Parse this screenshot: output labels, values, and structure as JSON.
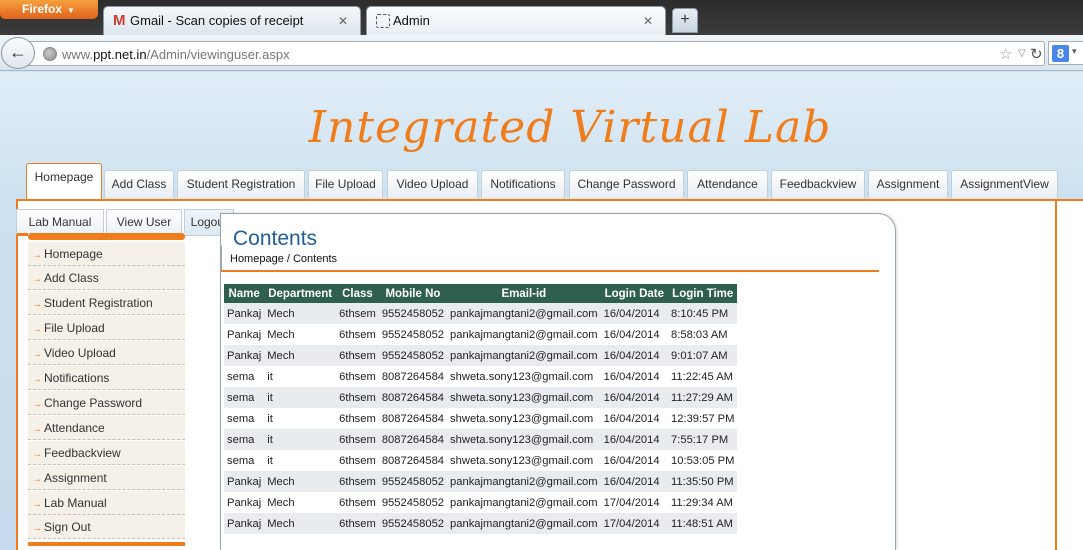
{
  "browser": {
    "menu_label": "Firefox",
    "tabs": [
      {
        "title": "Gmail - Scan copies of receipt",
        "icon": "gmail-icon"
      },
      {
        "title": "Admin",
        "icon": "page-icon"
      }
    ],
    "url_prefix": "www.",
    "url_domain": "ppt.net.in",
    "url_path": "/Admin/viewinguser.aspx"
  },
  "site": {
    "title": "Integrated Virtual Lab"
  },
  "menu": {
    "items": [
      "Homepage",
      "Add Class",
      "Student Registration",
      "File Upload",
      "Video Upload",
      "Notifications",
      "Change Password",
      "Attendance",
      "Feedbackview",
      "Assignment",
      "AssignmentView"
    ],
    "active": "Homepage"
  },
  "submenu": {
    "items": [
      "Lab Manual",
      "View User",
      "Logout"
    ]
  },
  "sidebar": {
    "items": [
      "Homepage",
      "Add Class",
      "Student Registration",
      "File Upload",
      "Video Upload",
      "Notifications",
      "Change Password",
      "Attendance",
      "Feedbackview",
      "Assignment",
      "Lab Manual",
      "Sign Out"
    ]
  },
  "content": {
    "title": "Contents",
    "breadcrumb": "Homepage / Contents"
  },
  "table": {
    "headers": [
      "Name",
      "Department",
      "Class",
      "Mobile No",
      "Email-id",
      "Login Date",
      "Login Time"
    ],
    "rows": [
      [
        "Pankaj",
        "Mech",
        "6thsem",
        "9552458052",
        "pankajmangtani2@gmail.com",
        "16/04/2014",
        "8:10:45 PM"
      ],
      [
        "Pankaj",
        "Mech",
        "6thsem",
        "9552458052",
        "pankajmangtani2@gmail.com",
        "16/04/2014",
        "8:58:03 AM"
      ],
      [
        "Pankaj",
        "Mech",
        "6thsem",
        "9552458052",
        "pankajmangtani2@gmail.com",
        "16/04/2014",
        "9:01:07 AM"
      ],
      [
        "sema",
        "it",
        "6thsem",
        "8087264584",
        "shweta.sony123@gmail.com",
        "16/04/2014",
        "11:22:45 AM"
      ],
      [
        "sema",
        "it",
        "6thsem",
        "8087264584",
        "shweta.sony123@gmail.com",
        "16/04/2014",
        "11:27:29 AM"
      ],
      [
        "sema",
        "it",
        "6thsem",
        "8087264584",
        "shweta.sony123@gmail.com",
        "16/04/2014",
        "12:39:57 PM"
      ],
      [
        "sema",
        "it",
        "6thsem",
        "8087264584",
        "shweta.sony123@gmail.com",
        "16/04/2014",
        "7:55:17 PM"
      ],
      [
        "sema",
        "it",
        "6thsem",
        "8087264584",
        "shweta.sony123@gmail.com",
        "16/04/2014",
        "10:53:05 PM"
      ],
      [
        "Pankaj",
        "Mech",
        "6thsem",
        "9552458052",
        "pankajmangtani2@gmail.com",
        "16/04/2014",
        "11:35:50 PM"
      ],
      [
        "Pankaj",
        "Mech",
        "6thsem",
        "9552458052",
        "pankajmangtani2@gmail.com",
        "17/04/2014",
        "11:29:34 AM"
      ],
      [
        "Pankaj",
        "Mech",
        "6thsem",
        "9552458052",
        "pankajmangtani2@gmail.com",
        "17/04/2014",
        "11:48:51 AM"
      ]
    ]
  },
  "colors": {
    "accent": "#f07d1c",
    "table_header": "#2f5f4e",
    "title_blue": "#1f5f99"
  }
}
